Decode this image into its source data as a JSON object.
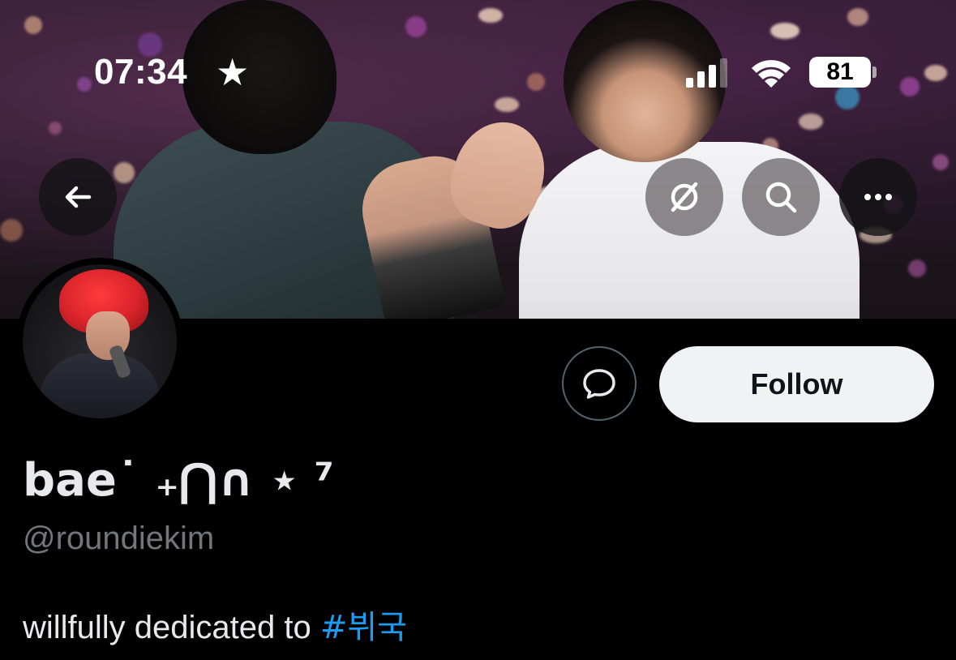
{
  "status_bar": {
    "time": "07:34",
    "star": "★",
    "battery": "81"
  },
  "banner": {
    "description_color_accent": "#2a1a2a"
  },
  "nav": {
    "back_icon": "back-arrow-icon",
    "grok_icon": "slashed-circle-icon",
    "search_icon": "search-icon",
    "more_icon": "more-icon"
  },
  "actions": {
    "message_icon": "message-bubble-icon",
    "follow_label": "Follow"
  },
  "profile": {
    "display_name": "bae˙ ₊⋂∩ ⋆ ⁷",
    "handle": "@roundiekim",
    "bio_text": "willfully dedicated to ",
    "bio_hashtag": "#뷔국"
  },
  "colors": {
    "background": "#000000",
    "text_primary": "#e7e9ea",
    "text_secondary": "#71767b",
    "link": "#1d9bf0",
    "follow_bg": "#eff3f4"
  }
}
